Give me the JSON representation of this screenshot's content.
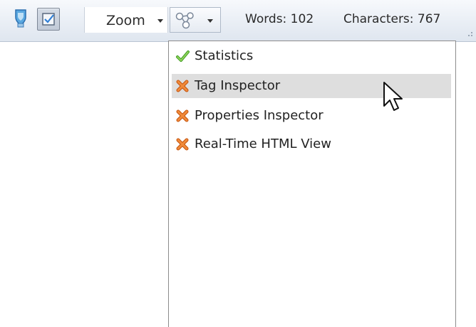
{
  "statusbar": {
    "zoom_label": "Zoom",
    "words": "Words: 102",
    "characters": "Characters: 767"
  },
  "menu": {
    "items": [
      {
        "label": "Statistics",
        "icon": "checkmark-icon",
        "state": "enabled"
      },
      {
        "label": "Tag Inspector",
        "icon": "cross-icon",
        "state": "disabled",
        "hover": true
      },
      {
        "label": "Properties Inspector",
        "icon": "cross-icon",
        "state": "disabled"
      },
      {
        "label": "Real-Time HTML View",
        "icon": "cross-icon",
        "state": "disabled"
      }
    ]
  },
  "colors": {
    "check": "#6cbf3c",
    "cross": "#e9711f",
    "hover": "#dedede"
  }
}
